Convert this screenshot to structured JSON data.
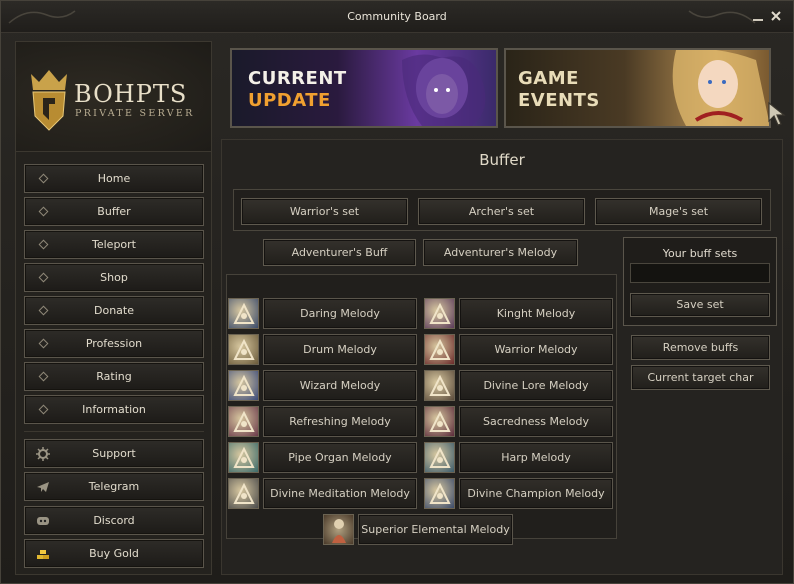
{
  "window": {
    "title": "Community Board"
  },
  "logo": {
    "name": "BOHPTS",
    "subtitle": "PRIVATE SERVER"
  },
  "sidebar": {
    "nav": [
      {
        "label": "Home"
      },
      {
        "label": "Buffer"
      },
      {
        "label": "Teleport"
      },
      {
        "label": "Shop"
      },
      {
        "label": "Donate"
      },
      {
        "label": "Profession"
      },
      {
        "label": "Rating"
      },
      {
        "label": "Information"
      }
    ],
    "links": [
      {
        "label": "Support",
        "icon": "gear-icon"
      },
      {
        "label": "Telegram",
        "icon": "telegram-icon"
      },
      {
        "label": "Discord",
        "icon": "discord-icon"
      },
      {
        "label": "Buy Gold",
        "icon": "gold-icon"
      }
    ]
  },
  "banners": {
    "left": {
      "line1": "CURRENT",
      "line2": "UPDATE"
    },
    "right": {
      "line1": "GAME",
      "line2": "EVENTS"
    }
  },
  "buffer": {
    "title": "Buffer",
    "sets": [
      "Warrior's set",
      "Archer's set",
      "Mage's set"
    ],
    "adventurer": [
      "Adventurer's Buff",
      "Adventurer's Melody"
    ],
    "skills": [
      {
        "label": "Daring Melody",
        "icon": "daring-melody-icon",
        "color": "#3a4a6a"
      },
      {
        "label": "Kinght Melody",
        "icon": "knight-melody-icon",
        "color": "#5a3a5a"
      },
      {
        "label": "Drum Melody",
        "icon": "drum-melody-icon",
        "color": "#6a5a3a"
      },
      {
        "label": "Warrior Melody",
        "icon": "warrior-melody-icon",
        "color": "#6a2a2a"
      },
      {
        "label": "Wizard Melody",
        "icon": "wizard-melody-icon",
        "color": "#3a4a7a"
      },
      {
        "label": "Divine Lore Melody",
        "icon": "divine-lore-melody-icon",
        "color": "#5a4a3a"
      },
      {
        "label": "Refreshing Melody",
        "icon": "refreshing-melody-icon",
        "color": "#6a3a4a"
      },
      {
        "label": "Sacredness Melody",
        "icon": "sacredness-melody-icon",
        "color": "#5a2a3a"
      },
      {
        "label": "Pipe Organ Melody",
        "icon": "pipe-organ-melody-icon",
        "color": "#3a6a6a"
      },
      {
        "label": "Harp Melody",
        "icon": "harp-melody-icon",
        "color": "#3a5a6a"
      },
      {
        "label": "Divine Meditation Melody",
        "icon": "divine-meditation-melody-icon",
        "color": "#4a4a4a"
      },
      {
        "label": "Divine Champion Melody",
        "icon": "divine-champion-melody-icon",
        "color": "#3a4a6a"
      }
    ],
    "last_skill": {
      "label": "Superior Elemental Melody",
      "icon": "superior-elemental-melody-icon"
    },
    "your_sets": {
      "label": "Your buff sets",
      "value": ""
    },
    "save_set": "Save set",
    "remove_buffs": "Remove buffs",
    "current_target": "Current target char"
  }
}
